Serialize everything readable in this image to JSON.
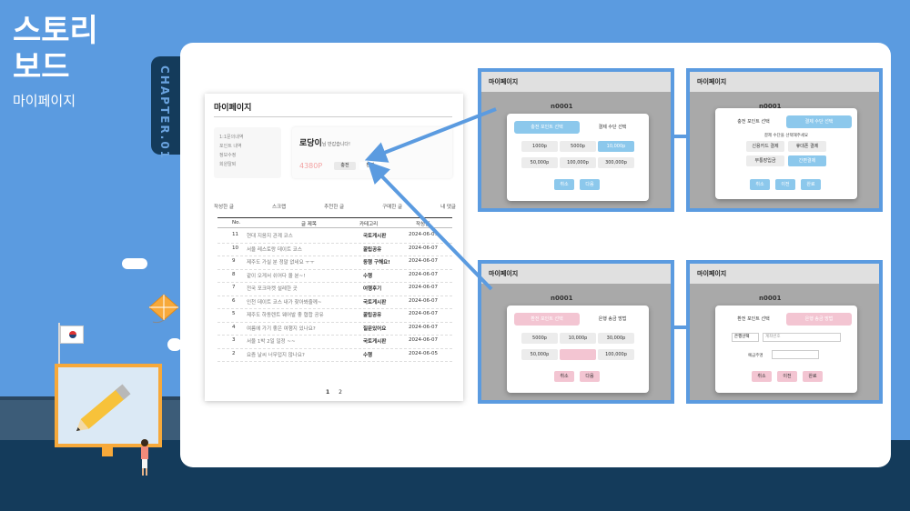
{
  "slide": {
    "title_line1": "스토리",
    "title_line2": "보드",
    "subtitle": "마이페이지",
    "chapter": "CHAPTER.01"
  },
  "colors": {
    "background": "#5b9be0",
    "navy": "#143b5b",
    "pink": "#f3c5d2",
    "sky": "#8cc8ec"
  },
  "mypage": {
    "title": "마이페이지",
    "side_menu": [
      "1:1문의내역",
      "포인트 내역",
      "정보수정",
      "회원탈퇴"
    ],
    "user_name": "로당이",
    "greeting": "님 반갑습니다!",
    "points": "4380P",
    "charge_label": "충전",
    "exchange_label": "환전",
    "tabs": [
      "작성한 글",
      "스크랩",
      "추천한 글",
      "구매한 글",
      "내 댓글"
    ],
    "columns": [
      "No.",
      "글 제목",
      "카테고리",
      "작성일"
    ],
    "rows": [
      {
        "no": "11",
        "title": "현대 지음지 관계 코스",
        "category": "국토게시판",
        "date": "2024-06-07"
      },
      {
        "no": "10",
        "title": "서울 레스토랑 데이트 코스",
        "category": "꿀팁공유",
        "date": "2024-06-07"
      },
      {
        "no": "9",
        "title": "제주도 가실 분 정말 없네요 ㅜㅜ",
        "category": "동행 구해요!",
        "date": "2024-06-07"
      },
      {
        "no": "8",
        "title": "같이 오게서 쉬어다 올 분~!",
        "category": "수행",
        "date": "2024-06-07"
      },
      {
        "no": "7",
        "title": "전국 포크마켓 설레한 곳",
        "category": "여행후기",
        "date": "2024-06-07"
      },
      {
        "no": "6",
        "title": "인천 데이트 코스 내가 찾아봐줄께~",
        "category": "국토게시판",
        "date": "2024-06-07"
      },
      {
        "no": "5",
        "title": "제주도 하동렌트 웨어발 좋 협합 공유",
        "category": "꿀팁공유",
        "date": "2024-06-07"
      },
      {
        "no": "4",
        "title": "여름에 가기 좋은 여행지 있나요?",
        "category": "질문있어요",
        "date": "2024-06-07"
      },
      {
        "no": "3",
        "title": "서울 1박 2일 일정 ~~",
        "category": "국토게시판",
        "date": "2024-06-07"
      },
      {
        "no": "2",
        "title": "요즘 날씨 너무덥지 않나요?",
        "category": "수행",
        "date": "2024-06-05"
      }
    ],
    "pages": [
      "1",
      "2"
    ]
  },
  "screens": {
    "header_title": "마이페이지",
    "ghost_user": "n0001",
    "ghost_greeting": "님 반갑습니다",
    "charge_point_tab": "충전 포인트 선택",
    "payment_tab": "결제 수단 선택",
    "bank_tab": "은행 송금 방법",
    "exchange_point_tab": "환전 포인트 선택",
    "exchange_bank_tab": "은행 송금 방법",
    "amounts_top": [
      "1000p",
      "5000p",
      "10,000p",
      "50,000p",
      "100,000p",
      "300,000p"
    ],
    "amounts_bottom": [
      "5000p",
      "10,000p",
      "30,000p",
      "50,000p",
      "100,000p"
    ],
    "pay_hint": "결제 수단을 선택해주세요",
    "pay_methods": [
      "신용카드 결제",
      "휴대폰 결제",
      "무통장입금",
      "간편결제"
    ],
    "cancel": "취소",
    "next": "다음",
    "prev": "이전",
    "done": "완료",
    "bank_select": "은행선택",
    "account_placeholder": "계좌번호",
    "holder_label": "예금주명"
  }
}
